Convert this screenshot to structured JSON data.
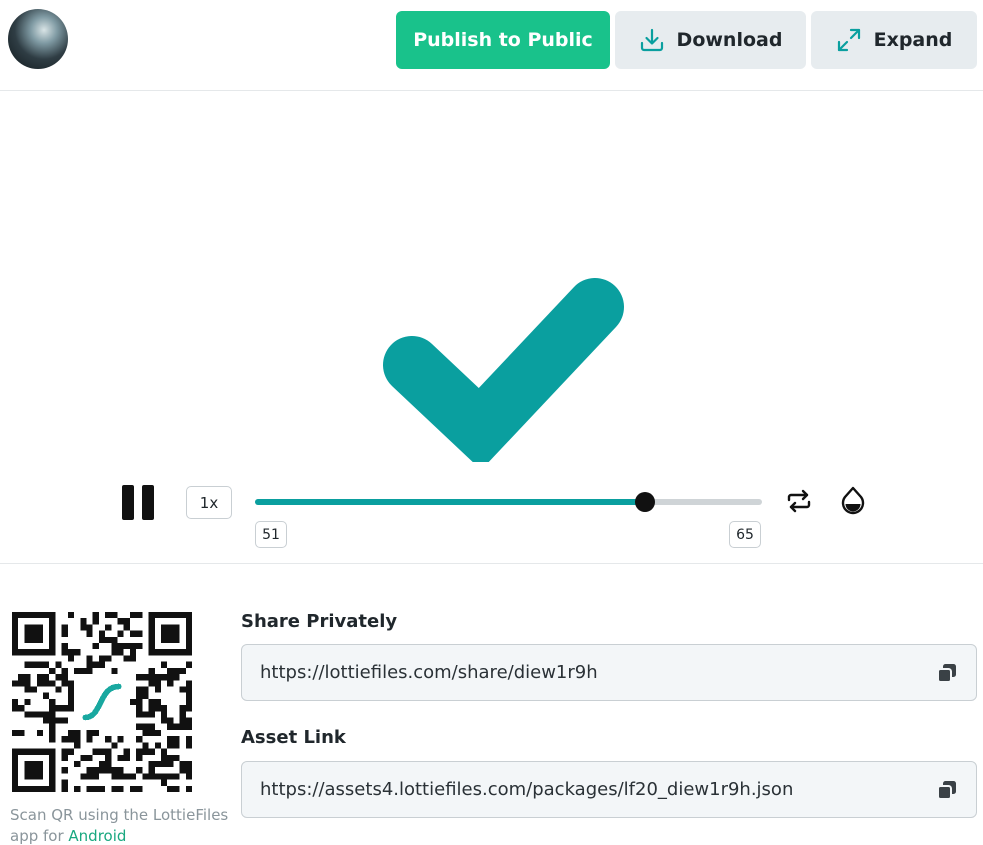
{
  "header": {
    "publish_label": "Publish to Public",
    "download_label": "Download",
    "expand_label": "Expand"
  },
  "player": {
    "speed": "1x",
    "start_frame": "51",
    "end_frame": "65",
    "progress": 0.77,
    "icons": {
      "pause": "pause-icon",
      "loop": "loop-icon",
      "background": "background-color-icon"
    }
  },
  "animation": {
    "color": "#0a9f9f",
    "shape": "checkmark"
  },
  "share": {
    "qr_caption_prefix": "Scan QR using the LottieFiles app for ",
    "qr_caption_link": "Android",
    "private_label": "Share Privately",
    "private_url": "https://lottiefiles.com/share/diew1r9h",
    "asset_label": "Asset Link",
    "asset_url": "https://assets4.lottiefiles.com/packages/lf20_diew1r9h.json"
  },
  "colors": {
    "accent": "#19c28b",
    "teal": "#0a9f9f",
    "button_gray": "#e7ecef"
  }
}
